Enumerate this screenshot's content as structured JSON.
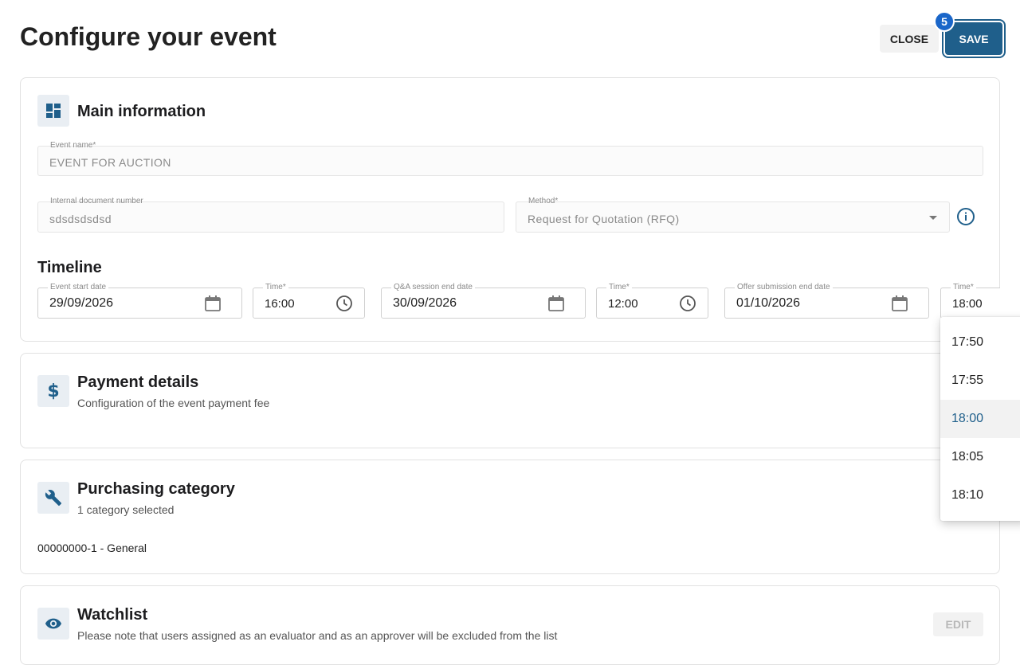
{
  "header": {
    "title": "Configure your event",
    "close_label": "CLOSE",
    "save_label": "SAVE",
    "badge": "5"
  },
  "main_info": {
    "title": "Main information",
    "event_name": {
      "label": "Event name*",
      "value": "EVENT FOR AUCTION"
    },
    "internal_doc": {
      "label": "Internal document number",
      "value": "sdsdsdsdsd"
    },
    "method": {
      "label": "Method*",
      "value": "Request for Quotation (RFQ)"
    },
    "timeline": {
      "title": "Timeline",
      "start_date": {
        "label": "Event start date",
        "value": "29/09/2026"
      },
      "start_time": {
        "label": "Time*",
        "value": "16:00"
      },
      "qa_date": {
        "label": "Q&A session end date",
        "value": "30/09/2026"
      },
      "qa_time": {
        "label": "Time*",
        "value": "12:00"
      },
      "offer_date": {
        "label": "Offer submission end date",
        "value": "01/10/2026"
      },
      "offer_time": {
        "label": "Time*",
        "value": "18:00"
      }
    }
  },
  "payment": {
    "title": "Payment details",
    "subtitle": "Configuration of the event payment fee"
  },
  "purchasing": {
    "title": "Purchasing category",
    "subtitle": "1 category selected",
    "item": "00000000-1 - General"
  },
  "watchlist": {
    "title": "Watchlist",
    "subtitle": "Please note that users assigned as an evaluator and as an approver will be excluded from the list",
    "edit_label": "EDIT"
  },
  "time_dropdown": {
    "options": [
      "17:50",
      "17:55",
      "18:00",
      "18:05",
      "18:10"
    ],
    "selected": "18:00"
  },
  "colors": {
    "primary": "#1f5f8b",
    "badge": "#1a66c9",
    "icon_bg": "#e9eef3"
  }
}
